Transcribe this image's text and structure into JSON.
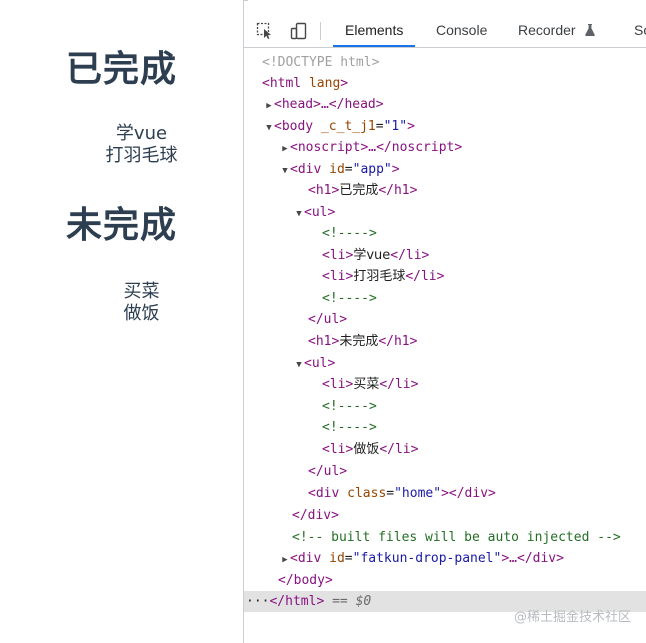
{
  "page": {
    "done_heading": "已完成",
    "done_items": [
      "学vue",
      "打羽毛球"
    ],
    "todo_heading": "未完成",
    "todo_items": [
      "买菜",
      "做饭"
    ]
  },
  "devtools": {
    "icons": [
      "inspect-icon",
      "device-toggle-icon"
    ],
    "tabs": [
      {
        "label": "Elements",
        "active": true
      },
      {
        "label": "Console",
        "active": false
      },
      {
        "label": "Recorder",
        "active": false
      },
      {
        "label": "So",
        "active": false
      }
    ],
    "dom": {
      "doctype": "<!DOCTYPE html>",
      "html_tag": "<html",
      "html_attr": "lang",
      "html_close": ">",
      "head": "<head>…</head>",
      "body_open": "<body",
      "body_attr": "_c_t_j1",
      "body_val": "\"1\"",
      "body_close": ">",
      "noscript": "<noscript>…</noscript>",
      "div_app_open": "<div",
      "div_app_attr": "id",
      "div_app_val": "\"app\"",
      "h1_open": "<h1>",
      "h1_close": "</h1>",
      "h1_done_text": "已完成",
      "ul_open": "<ul>",
      "ul_close": "</ul>",
      "comment_empty": "<!---->",
      "li_open": "<li>",
      "li_close": "</li>",
      "li_1": "学vue",
      "li_2": "打羽毛球",
      "h1_todo_text": "未完成",
      "li_3": "买菜",
      "li_4": "做饭",
      "div_home_open": "<div",
      "div_home_attr": "class",
      "div_home_val": "\"home\"",
      "div_home_close": "></div>",
      "div_close": "</div>",
      "injected_comment": "<!-- built files will be auto injected -->",
      "fatkun_open": "<div",
      "fatkun_attr": "id",
      "fatkun_val": "\"fatkun-drop-panel\"",
      "fatkun_rest": ">…</div>",
      "body_end": "</body>",
      "selected_prefix": "···",
      "html_end": "</html>",
      "eq": " == $0"
    }
  },
  "watermark": "@稀土掘金技术社区",
  "colors": {
    "tag": "#881280",
    "attr": "#994500",
    "value": "#1a1aa6",
    "comment": "#236e25",
    "accent": "#1a73e8",
    "heading": "#2c3e50"
  }
}
